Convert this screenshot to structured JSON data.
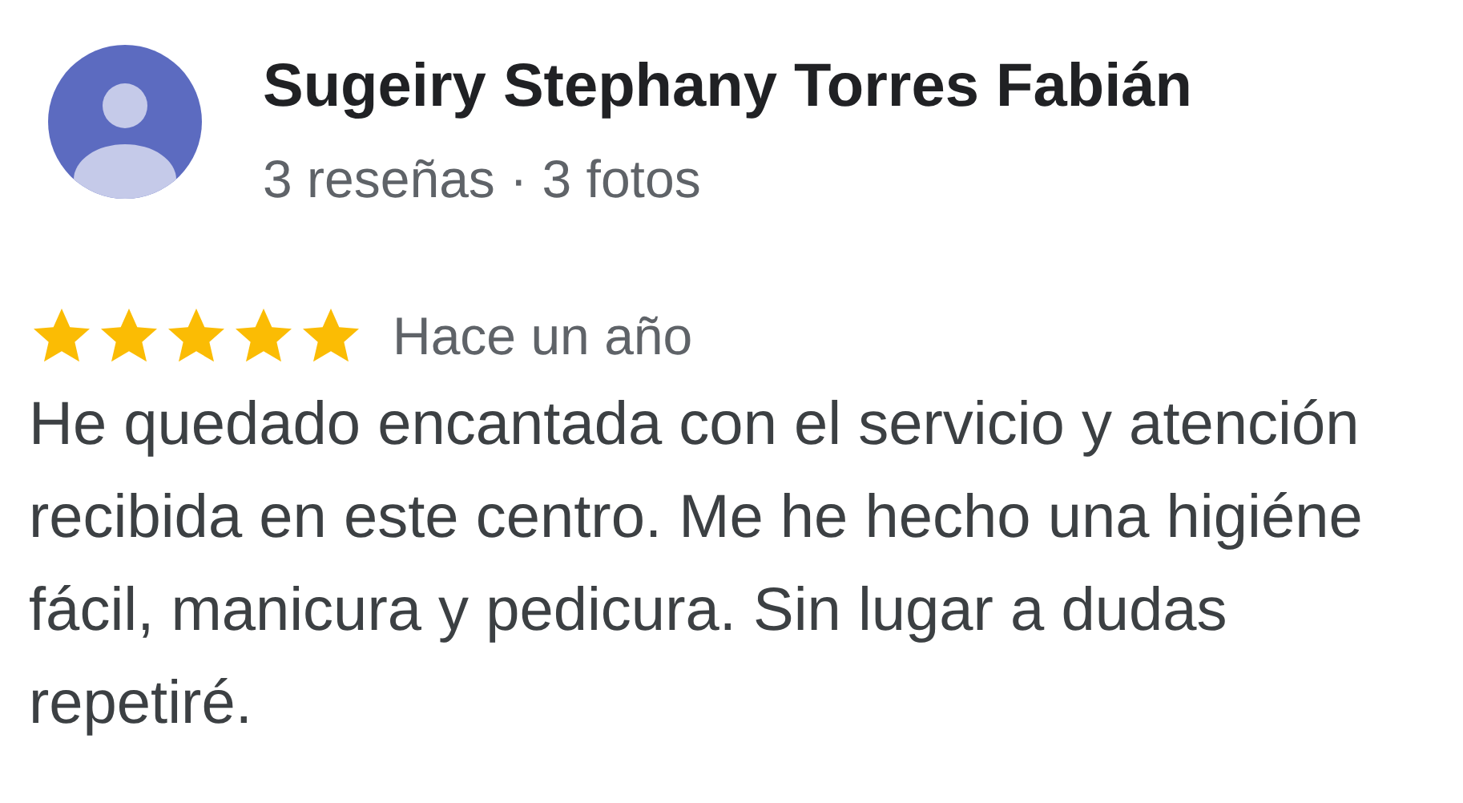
{
  "reviewer": {
    "name": "Sugeiry Stephany Torres Fabián",
    "stats": "3 reseñas · 3 fotos"
  },
  "review": {
    "stars": 5,
    "time": "Hace un año",
    "text": "He quedado encantada con el servicio y atención recibida en este centro. Me he hecho una higiéne fácil, manicura y pedicura. Sin lugar a dudas repetiré."
  }
}
